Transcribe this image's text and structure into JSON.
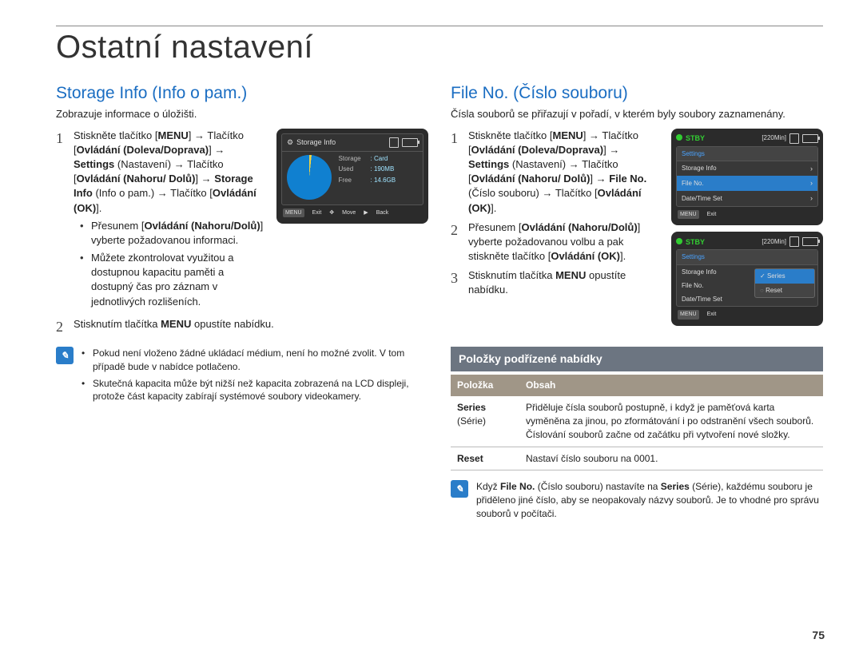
{
  "page_title": "Ostatní nastavení",
  "page_number": "75",
  "left": {
    "heading": "Storage Info (Info o pam.)",
    "intro": "Zobrazuje informace o úložišti.",
    "step1_a": "Stiskněte tlačítko [",
    "step1_menu": "MENU",
    "step1_b": "] ",
    "step1_c": "Tlačítko [",
    "step1_ctrl1": "Ovládání (Doleva/Doprava)",
    "step1_d": "] ",
    "step1_settings": "Settings",
    "step1_e": " (Nastavení) ",
    "step1_f": " Tlačítko [",
    "step1_ctrl2": "Ovládání (Nahoru/ Dolů)",
    "step1_g": "] ",
    "step1_si": "Storage Info",
    "step1_h": " (Info o pam.) ",
    "step1_i": " Tlačítko [",
    "step1_ok": "Ovládání (OK)",
    "step1_j": "].",
    "bullet1_a": "Přesunem [",
    "bullet1_ctrl": "Ovládání (Nahoru/Dolů)",
    "bullet1_b": "] vyberte požadovanou informaci.",
    "bullet2": "Můžete zkontrolovat využitou a dostupnou kapacitu paměti a dostupný čas pro záznam v jednotlivých rozlišeních.",
    "step2_a": "Stisknutím tlačítka ",
    "step2_menu": "MENU",
    "step2_b": " opustíte nabídku.",
    "noteA": "Pokud není vloženo žádné ukládací médium, není ho možné zvolit. V tom případě bude v nabídce potlačeno.",
    "noteB": "Skutečná kapacita může být nižší než kapacita zobrazená na LCD displeji, protože část kapacity zabírají systémové soubory videokamery."
  },
  "right": {
    "heading": "File No. (Číslo souboru)",
    "intro": "Čísla souborů se přiřazují v pořadí, v kterém byly soubory zaznamenány.",
    "step1_a": "Stiskněte tlačítko [",
    "step1_menu": "MENU",
    "step1_b": "] ",
    "step1_c": "Tlačítko [",
    "step1_ctrl1": "Ovládání (Doleva/Doprava)",
    "step1_d": "] ",
    "step1_settings": "Settings",
    "step1_e": " (Nastavení) ",
    "step1_f": " Tlačítko [",
    "step1_ctrl2": "Ovládání (Nahoru/ Dolů)",
    "step1_g": "] ",
    "step1_fn": "File No.",
    "step1_h": " (Číslo souboru) ",
    "step1_i": " Tlačítko [",
    "step1_ok": "Ovládání (OK)",
    "step1_j": "].",
    "step2_a": "Přesunem [",
    "step2_ctrl": "Ovládání (Nahoru/Dolů)",
    "step2_b": "] vyberte požadovanou volbu a pak stiskněte tlačítko [",
    "step2_ok": "Ovládání (OK)",
    "step2_c": "].",
    "step3_a": "Stisknutím tlačítka ",
    "step3_menu": "MENU",
    "step3_b": " opustíte nabídku.",
    "subhead": "Položky podřízené nabídky",
    "th1": "Položka",
    "th2": "Obsah",
    "row1a": "Series",
    "row1b": "(Série)",
    "row1c": "Přiděluje čísla souborů postupně, i když je paměťová karta vyměněna za jinou, po zformátování i po odstranění všech souborů. Číslování souborů začne od začátku při vytvoření nové složky.",
    "row2a": "Reset",
    "row2b": "Nastaví číslo souboru na 0001.",
    "note_a": "Když ",
    "note_fn": "File No.",
    "note_b": " (Číslo souboru) nastavíte na ",
    "note_series": "Series",
    "note_c": " (Série), každému souboru je přiděleno jiné číslo, aby se neopakovaly názvy souborů. Je to vhodné pro správu souborů v počítači."
  },
  "lcd_storage": {
    "title": "Storage Info",
    "l1": "Storage",
    "v1": ": Card",
    "l2": "Used",
    "v2": ": 190MB",
    "l3": "Free",
    "v3": ": 14.6GB",
    "menu": "MENU",
    "exit": "Exit",
    "move": "Move",
    "back": "Back"
  },
  "lcd1": {
    "stby": "STBY",
    "time": "[220Min]",
    "settings": "Settings",
    "r1": "Storage Info",
    "r2": "File No.",
    "r3": "Date/Time Set",
    "menu": "MENU",
    "exit": "Exit"
  },
  "lcd2": {
    "stby": "STBY",
    "time": "[220Min]",
    "settings": "Settings",
    "r1": "Storage Info",
    "r2": "File No.",
    "r3": "Date/Time Set",
    "s1": "Series",
    "s2": "Reset",
    "menu": "MENU",
    "exit": "Exit"
  }
}
